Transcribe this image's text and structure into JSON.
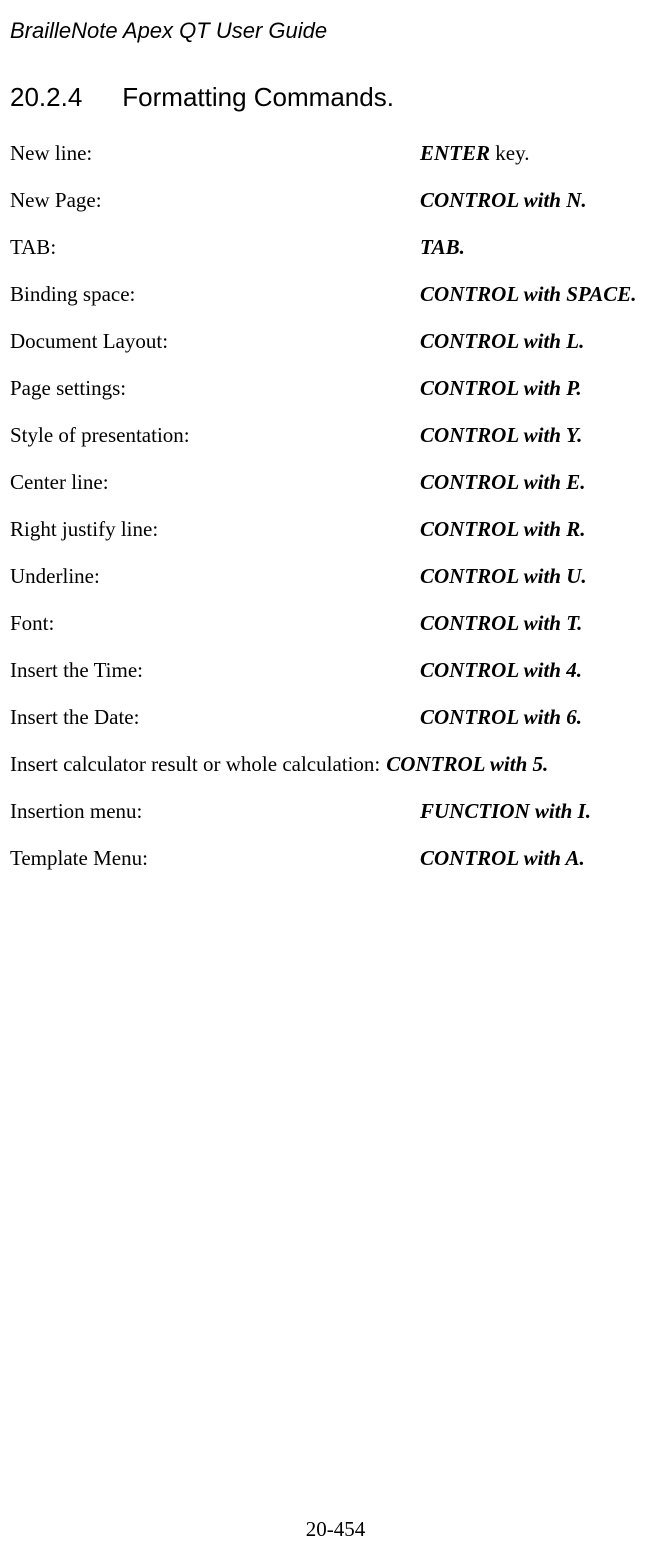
{
  "header": {
    "title": "BrailleNote Apex QT User Guide"
  },
  "section": {
    "number": "20.2.4",
    "title": "Formatting Commands."
  },
  "commands": [
    {
      "label": "New line:",
      "value_bold": "ENTER",
      "value_plain": " key."
    },
    {
      "label": "New Page:",
      "value_bold": "CONTROL with N.",
      "value_plain": ""
    },
    {
      "label": "TAB:",
      "value_bold": "TAB.",
      "value_plain": ""
    },
    {
      "label": "Binding space:",
      "value_bold": "CONTROL with SPACE.",
      "value_plain": ""
    },
    {
      "label": "Document Layout:",
      "value_bold": "CONTROL with L.",
      "value_plain": ""
    },
    {
      "label": "Page settings:",
      "value_bold": "CONTROL with P.",
      "value_plain": ""
    },
    {
      "label": "Style of presentation:",
      "value_bold": "CONTROL with Y.",
      "value_plain": ""
    },
    {
      "label": "Center line:",
      "value_bold": "CONTROL with E.",
      "value_plain": ""
    },
    {
      "label": "Right justify line:",
      "value_bold": "CONTROL with R.",
      "value_plain": ""
    },
    {
      "label": "Underline:",
      "value_bold": "CONTROL with U.",
      "value_plain": ""
    },
    {
      "label": "Font:",
      "value_bold": "CONTROL with T.",
      "value_plain": ""
    },
    {
      "label": "Insert the Time:",
      "value_bold": "CONTROL with 4.",
      "value_plain": ""
    },
    {
      "label": "Insert the Date:",
      "value_bold": "CONTROL with 6.",
      "value_plain": ""
    },
    {
      "label": "Insert calculator result or whole calculation: ",
      "value_bold": "CONTROL with 5.",
      "value_plain": "",
      "wide": true
    },
    {
      "label": "Insertion menu:",
      "value_bold": "FUNCTION with I.",
      "value_plain": ""
    },
    {
      "label": "Template Menu:",
      "value_bold": "CONTROL with A.",
      "value_plain": ""
    }
  ],
  "footer": {
    "page_number": "20-454"
  }
}
